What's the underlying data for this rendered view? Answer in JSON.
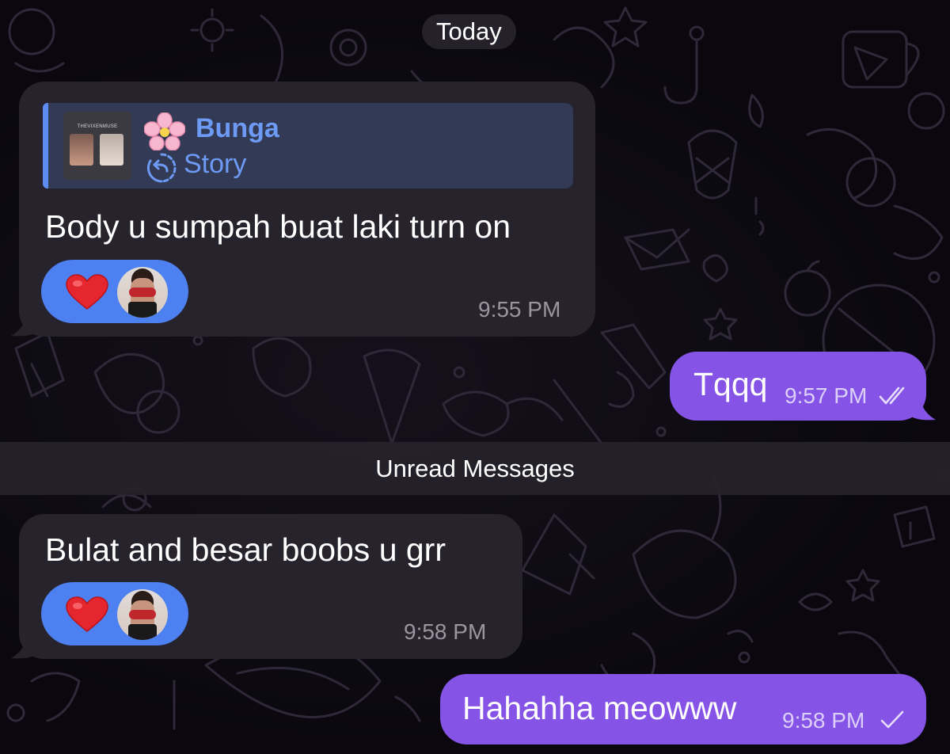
{
  "date_separator": "Today",
  "unread_separator": "Unread Messages",
  "messages": [
    {
      "direction": "incoming",
      "reply": {
        "thumbnail_caption": "THEVIXENMUSE",
        "emoji": "🌸",
        "name": "Bunga",
        "icon": "story-reply-icon",
        "label": "Story"
      },
      "text": "Body u sumpah buat laki turn on",
      "reactions": [
        {
          "emoji": "heart",
          "by": "avatar"
        }
      ],
      "time": "9:55 PM"
    },
    {
      "direction": "outgoing",
      "text": "Tqqq",
      "time": "9:57 PM",
      "status": "read-double-check-icon"
    },
    {
      "direction": "incoming",
      "text": "Bulat and besar boobs u grr",
      "reactions": [
        {
          "emoji": "heart",
          "by": "avatar"
        }
      ],
      "time": "9:58 PM"
    },
    {
      "direction": "outgoing",
      "text": "Hahahha meowww",
      "time": "9:58 PM",
      "status": "sent-single-check-icon"
    }
  ],
  "colors": {
    "background": "#0b0910",
    "incoming_bubble": "#27232d",
    "outgoing_bubble": "#8553e6",
    "reply_accent": "#6d9af4",
    "reaction_pill": "#4d80f0"
  }
}
